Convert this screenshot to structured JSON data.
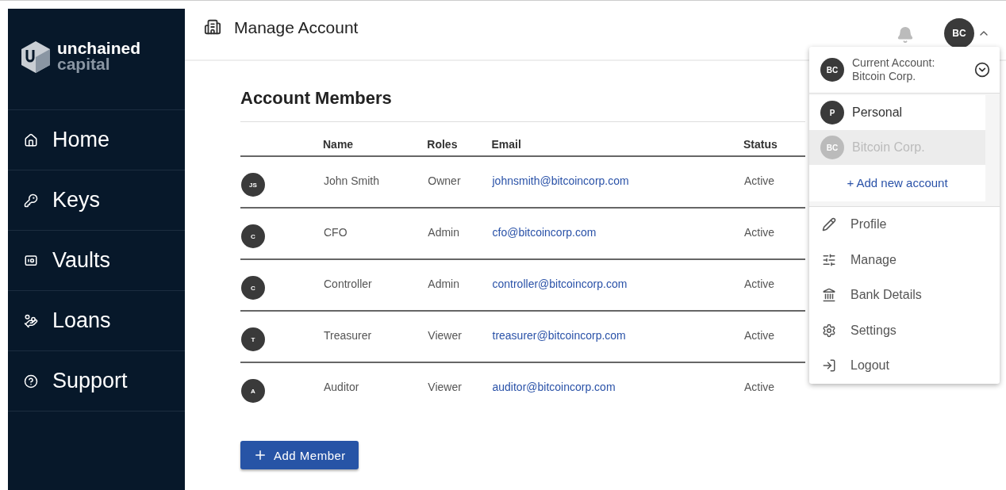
{
  "sidebar": {
    "logo": {
      "line1": "unchained",
      "line2": "capital"
    },
    "items": [
      {
        "label": "Home"
      },
      {
        "label": "Keys"
      },
      {
        "label": "Vaults"
      },
      {
        "label": "Loans"
      },
      {
        "label": "Support"
      }
    ]
  },
  "header": {
    "title": "Manage Account",
    "avatar": "BC"
  },
  "section": {
    "title": "Account Members"
  },
  "table": {
    "columns": [
      "Name",
      "Roles",
      "Email",
      "Status"
    ],
    "rows": [
      {
        "initials": "JS",
        "name": "John Smith",
        "role": "Owner",
        "email": "johnsmith@bitcoincorp.com",
        "status": "Active"
      },
      {
        "initials": "C",
        "name": "CFO",
        "role": "Admin",
        "email": "cfo@bitcoincorp.com",
        "status": "Active"
      },
      {
        "initials": "C",
        "name": "Controller",
        "role": "Admin",
        "email": "controller@bitcoincorp.com",
        "status": "Active"
      },
      {
        "initials": "T",
        "name": "Treasurer",
        "role": "Viewer",
        "email": "treasurer@bitcoincorp.com",
        "status": "Active"
      },
      {
        "initials": "A",
        "name": "Auditor",
        "role": "Viewer",
        "email": "auditor@bitcoincorp.com",
        "status": "Active"
      }
    ]
  },
  "add_button": "Add Member",
  "menu": {
    "current": {
      "initials": "BC",
      "label": "Current Account:",
      "name": "Bitcoin Corp."
    },
    "accounts": [
      {
        "initials": "P",
        "name": "Personal",
        "selected": false
      },
      {
        "initials": "BC",
        "name": "Bitcoin Corp.",
        "selected": true
      }
    ],
    "add_account": "+ Add new account",
    "items": [
      {
        "label": "Profile"
      },
      {
        "label": "Manage"
      },
      {
        "label": "Bank Details"
      },
      {
        "label": "Settings"
      },
      {
        "label": "Logout"
      }
    ]
  }
}
